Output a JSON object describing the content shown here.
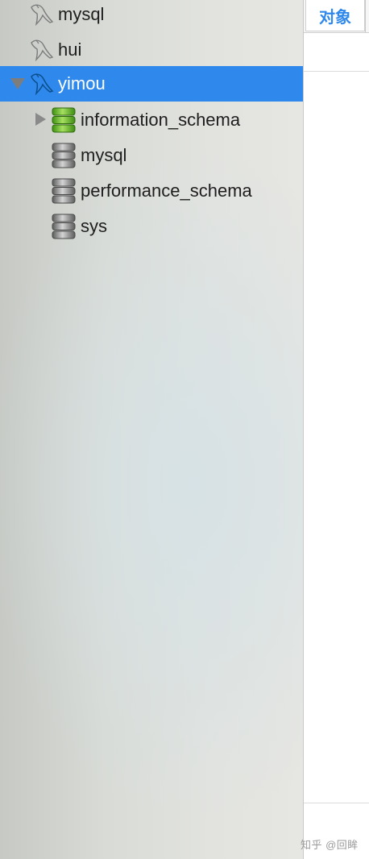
{
  "sidebar": {
    "connections": [
      {
        "label": "mysql",
        "icon": "mysql-dolphin-icon",
        "expanded": false,
        "selected": false
      },
      {
        "label": "hui",
        "icon": "mysql-dolphin-icon",
        "expanded": false,
        "selected": false
      },
      {
        "label": "yimou",
        "icon": "mysql-dolphin-icon",
        "expanded": true,
        "selected": true
      }
    ],
    "databases": [
      {
        "label": "information_schema",
        "icon": "database-open-icon",
        "has_children": true
      },
      {
        "label": "mysql",
        "icon": "database-icon",
        "has_children": false
      },
      {
        "label": "performance_schema",
        "icon": "database-icon",
        "has_children": false
      },
      {
        "label": "sys",
        "icon": "database-icon",
        "has_children": false
      }
    ]
  },
  "main": {
    "tabs": [
      {
        "label": "对象",
        "active": true
      }
    ]
  },
  "watermark": "知乎 @回眸",
  "colors": {
    "selection": "#2f88ec",
    "db_open": "#6cbf2a",
    "db_closed": "#8c8c8c",
    "tab_text": "#2f88ec"
  }
}
